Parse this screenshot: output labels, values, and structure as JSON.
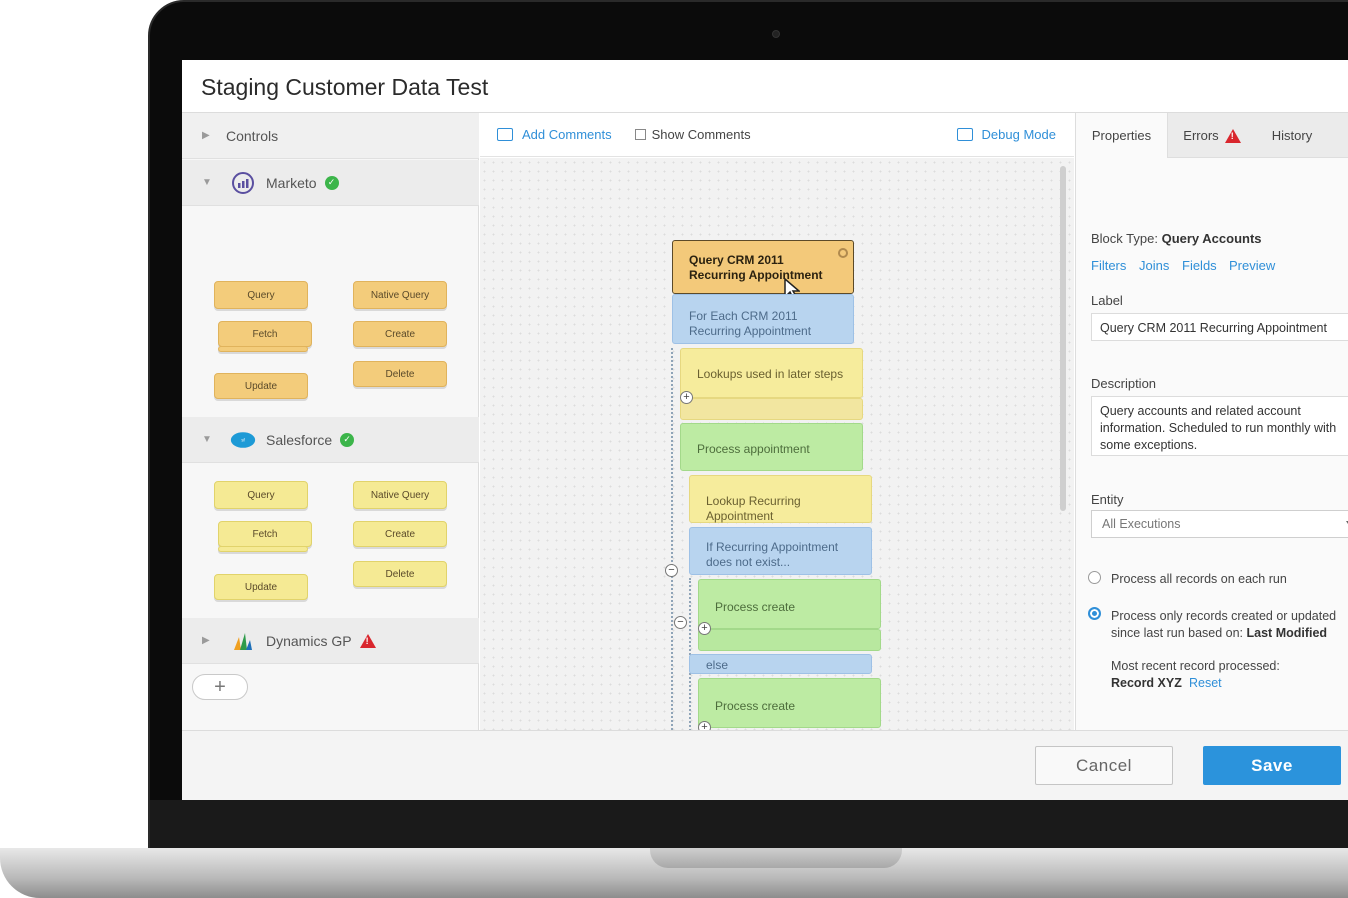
{
  "app": {
    "title": "Staging Customer Data Test"
  },
  "left_panel": {
    "controls_label": "Controls",
    "groups": [
      {
        "name": "Marketo",
        "status": "ok",
        "blocks": [
          "Query",
          "Native Query",
          "Fetch",
          "Create",
          "Update",
          "Delete"
        ]
      },
      {
        "name": "Salesforce",
        "status": "ok",
        "blocks": [
          "Query",
          "Native Query",
          "Fetch",
          "Create",
          "Update",
          "Delete"
        ]
      },
      {
        "name": "Dynamics GP",
        "status": "warning"
      }
    ],
    "add_label": "+"
  },
  "toolbar": {
    "add_comments": "Add Comments",
    "show_comments": "Show Comments",
    "debug_mode": "Debug Mode"
  },
  "canvas": {
    "blocks": {
      "query": "Query CRM 2011 Recurring Appointment",
      "for_each": "For Each CRM 2011 Recurring Appointment",
      "lookups": "Lookups used in later steps",
      "process_appointment": "Process appointment",
      "lookup_recurring": "Lookup Recurring Appointment",
      "if_not_exist": "If Recurring Appointment does not exist...",
      "process_create_1": "Process create",
      "else": "else",
      "process_create_2": "Process create"
    }
  },
  "right_panel": {
    "tabs": [
      "Properties",
      "Errors",
      "History"
    ],
    "block_type_label": "Block Type:",
    "block_type_value": "Query Accounts",
    "links": [
      "Filters",
      "Joins",
      "Fields",
      "Preview"
    ],
    "label_heading": "Label",
    "label_value": "Query CRM 2011 Recurring Appointment",
    "description_heading": "Description",
    "description_value": "Query accounts and related account information. Scheduled to run monthly with some exceptions.",
    "entity_heading": "Entity",
    "entity_value": "All Executions",
    "radio_all": "Process all records on each run",
    "radio_updated_prefix": "Process only records created or updated since last run based on:",
    "radio_updated_field": "Last Modified",
    "recent_label": "Most recent record processed:",
    "recent_value": "Record XYZ",
    "reset_label": "Reset"
  },
  "footer": {
    "cancel": "Cancel",
    "save": "Save"
  },
  "colors": {
    "accent": "#2b93dc",
    "ok": "#3cb54a",
    "warning": "#d9262d"
  }
}
